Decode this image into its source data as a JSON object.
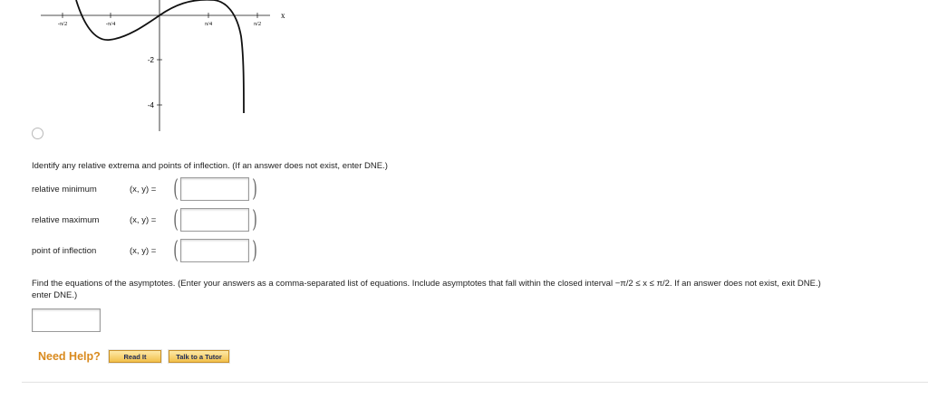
{
  "graph": {
    "axis_x_label": "x",
    "x_ticks": [
      "-π/2",
      "-π/4",
      "π/4",
      "π/2"
    ],
    "y_ticks": [
      "-2",
      "-4"
    ]
  },
  "prompt": "Identify any relative extrema and points of inflection. (If an answer does not exist, enter DNE.)",
  "fields": [
    {
      "label": "relative minimum",
      "coord": "(x, y) =",
      "value": ""
    },
    {
      "label": "relative maximum",
      "coord": "(x, y) =",
      "value": ""
    },
    {
      "label": "point of inflection",
      "coord": "(x, y) =",
      "value": ""
    }
  ],
  "asymptote": {
    "line1": "Find the equations of the asymptotes. (Enter your answers as a comma-separated list of equations. Include asymptotes that fall within the closed interval −π/2 ≤ x ≤ π/2. If an answer does not exist, exit DNE.)",
    "line2": "enter DNE.)",
    "value": ""
  },
  "help": {
    "label": "Need Help?",
    "read_it": "Read It",
    "talk_to_tutor": "Talk to a Tutor"
  }
}
